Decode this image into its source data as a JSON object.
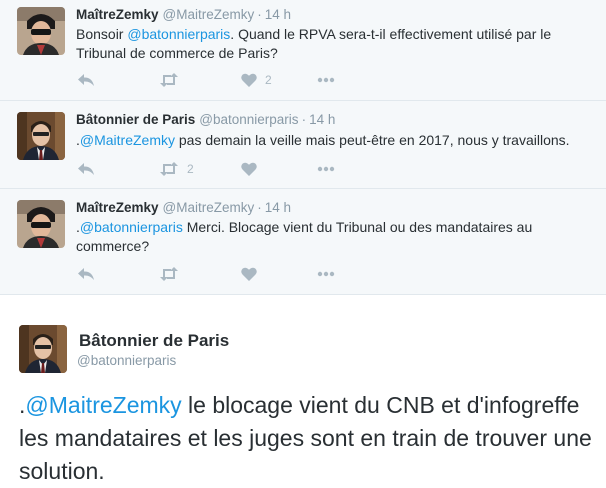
{
  "replies": [
    {
      "name": "MaîtreZemky",
      "handle": "@MaitreZemky",
      "sep": "·",
      "time": "14 h",
      "pre": "Bonsoir ",
      "mention": "@batonnierparis",
      "post": ". Quand le RPVA sera-t-il effectivement utilisé par le Tribunal de commerce de Paris?",
      "likes": "2",
      "retweets": ""
    },
    {
      "name": "Bâtonnier de Paris",
      "handle": "@batonnierparis",
      "sep": "·",
      "time": "14 h",
      "pre": ".",
      "mention": "@MaitreZemky",
      "post": " pas demain la veille mais peut-être en 2017, nous y travaillons.",
      "likes": "",
      "retweets": "2"
    },
    {
      "name": "MaîtreZemky",
      "handle": "@MaitreZemky",
      "sep": "·",
      "time": "14 h",
      "pre": ".",
      "mention": "@batonnierparis",
      "post": " Merci. Blocage vient du Tribunal ou des mandataires au commerce?",
      "likes": "",
      "retweets": ""
    }
  ],
  "main_tweet": {
    "name": "Bâtonnier de Paris",
    "handle": "@batonnierparis",
    "pre": ".",
    "mention": "@MaitreZemky",
    "post": " le blocage vient du CNB et d'infogreffe les mandataires et les juges sont en train de trouver une solution."
  },
  "icons": {
    "reply": "reply-icon",
    "retweet": "retweet-icon",
    "like": "heart-icon",
    "more": "more-icon"
  },
  "colors": {
    "mention": "#1b95e0",
    "muted": "#8899a6",
    "icon": "#aab8c2",
    "thread_bg": "#f5f8fa"
  }
}
